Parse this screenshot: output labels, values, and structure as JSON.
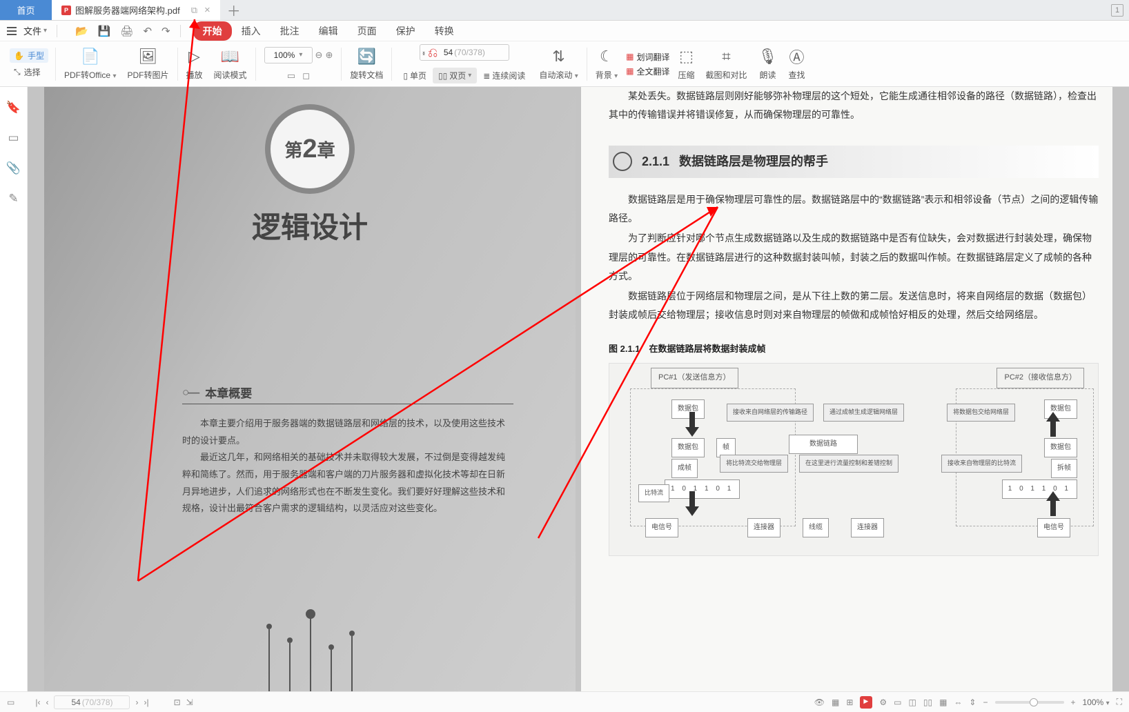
{
  "tabs": {
    "home": "首页",
    "active": "图解服务器端网络架构.pdf",
    "count": "1"
  },
  "quick": {
    "file": "文件"
  },
  "menus": [
    "开始",
    "插入",
    "批注",
    "编辑",
    "页面",
    "保护",
    "转换"
  ],
  "hand": "手型",
  "select": "选择",
  "tool": {
    "pdf_office": "PDF转Office",
    "pdf_img": "PDF转图片",
    "play": "播放",
    "read_mode": "阅读模式",
    "zoom": "100%",
    "rotate": "旋转文档",
    "single": "单页",
    "double": "双页",
    "cont": "连续阅读",
    "autoscroll": "自动滚动",
    "bg": "背景",
    "dict": "划词翻译",
    "fulltrans": "全文翻译",
    "compress": "压缩",
    "screenshot": "截图和对比",
    "read": "朗读",
    "find": "查找"
  },
  "page": {
    "current": "54",
    "total": "(70/378)"
  },
  "doc": {
    "chapter_pre": "第",
    "chapter_n": "2",
    "chapter_post": "章",
    "chapter_title": "逻辑设计",
    "overview_head": "本章概要",
    "ov_p1": "本章主要介绍用于服务器端的数据链路层和网络层的技术，以及使用这些技术时的设计要点。",
    "ov_p2": "最近这几年，和网络相关的基础技术并未取得较大发展，不过倒是变得越发纯粹和简练了。然而，用于服务器端和客户端的刀片服务器和虚拟化技术等却在日新月异地进步，人们追求的网络形式也在不断发生变化。我们要好好理解这些技术和规格，设计出最符合客户需求的逻辑结构，以灵活应对这些变化。",
    "r_intro": "某处丢失。数据链路层则刚好能够弥补物理层的这个短处，它能生成通往相邻设备的路径（数据链路），检查出其中的传输错误并将错误修复，从而确保物理层的可靠性。",
    "sec_num": "2.1.1",
    "sec_title": "数据链路层是物理层的帮手",
    "r_p1": "数据链路层是用于确保物理层可靠性的层。数据链路层中的“数据链路”表示和相邻设备（节点）之间的逻辑传输路径。",
    "r_p2": "为了判断应针对哪个节点生成数据链路以及生成的数据链路中是否有位缺失，会对数据进行封装处理，确保物理层的可靠性。在数据链路层进行的这种数据封装叫帧，封装之后的数据叫作帧。在数据链路层定义了成帧的各种方式。",
    "r_p3": "数据链路层位于网络层和物理层之间，是从下往上数的第二层。发送信息时，将来自网络层的数据（数据包）封装成帧后交给物理层；接收信息时则对来自物理层的帧做和成帧恰好相反的处理，然后交给网络层。",
    "fig_cap": "图 2.1.1　在数据链路层将数据封装成帧",
    "fig": {
      "pc1": "PC#1（发送信息方）",
      "pc2": "PC#2（接收信息方）",
      "pkt": "数据包",
      "frame": "帧",
      "mkframe": "成帧",
      "deframe": "拆帧",
      "t1": "接收来自网络层的传输路径",
      "t2": "通过成帧生成逻辑网络层",
      "t3": "将数据包交给网络层",
      "t4": "将比特流交给物理层",
      "t5": "在这里进行流量控制和差错控制",
      "t6": "接收来自物理层的比特流",
      "link": "数据链路",
      "bitstream": "比特流",
      "esig": "电信号",
      "conn": "连接器",
      "wire": "线缆",
      "bits": "1  0  1  1  0  1"
    }
  },
  "status": {
    "zoom": "100%"
  }
}
